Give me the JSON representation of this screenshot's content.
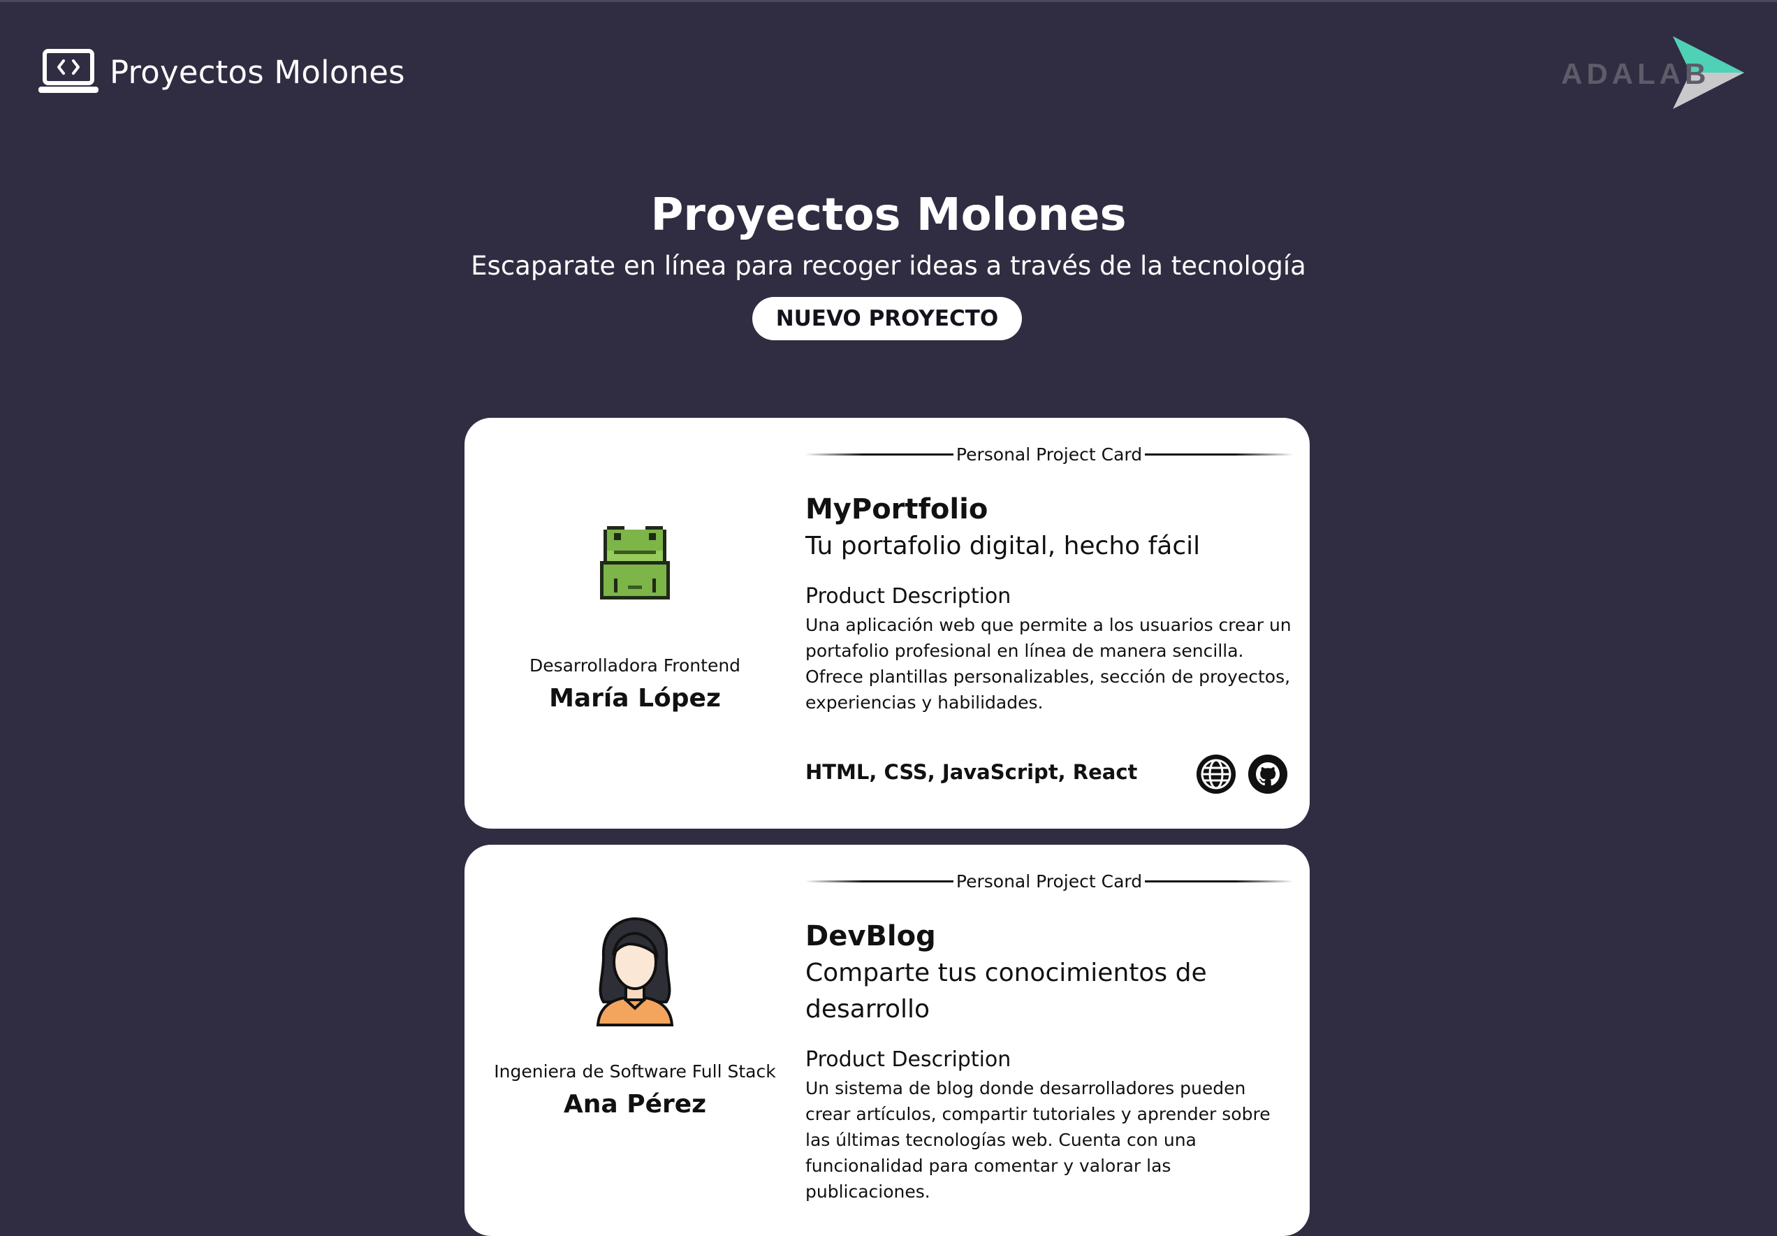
{
  "header": {
    "brand_label": "Proyectos Molones",
    "brand_icon": "laptop-code-icon",
    "partner_logo": "ADALAB"
  },
  "hero": {
    "title": "Proyectos Molones",
    "subtitle": "Escaparate en línea para recoger ideas a través de la tecnología",
    "new_project_button": "NUEVO PROYECTO"
  },
  "cards": [
    {
      "label": "Personal Project Card",
      "avatar_icon": "frog-pixel-icon",
      "author_job": "Desarrolladora Frontend",
      "author_name": "María López",
      "name": "MyPortfolio",
      "slogan": "Tu portafolio digital, hecho fácil",
      "description_title": "Product Description",
      "description": "Una aplicación web que permite a los usuarios crear un portafolio profesional en línea de manera sencilla. Ofrece plantillas personalizables, sección de proyectos, experiencias y habilidades.",
      "technologies": "HTML, CSS, JavaScript, React",
      "links": [
        "globe-icon",
        "github-icon"
      ]
    },
    {
      "label": "Personal Project Card",
      "avatar_icon": "woman-avatar-icon",
      "author_job": "Ingeniera de Software Full Stack",
      "author_name": "Ana Pérez",
      "name": "DevBlog",
      "slogan": "Comparte tus conocimientos de desarrollo",
      "description_title": "Product Description",
      "description": "Un sistema de blog donde desarrolladores pueden crear artículos, compartir tutoriales y aprender sobre las últimas tecnologías web. Cuenta con una funcionalidad para comentar y valorar las publicaciones."
    }
  ],
  "colors": {
    "background": "#302d42",
    "card": "#ffffff",
    "accent_teal": "#4fd1b5",
    "text_dark": "#111111"
  }
}
